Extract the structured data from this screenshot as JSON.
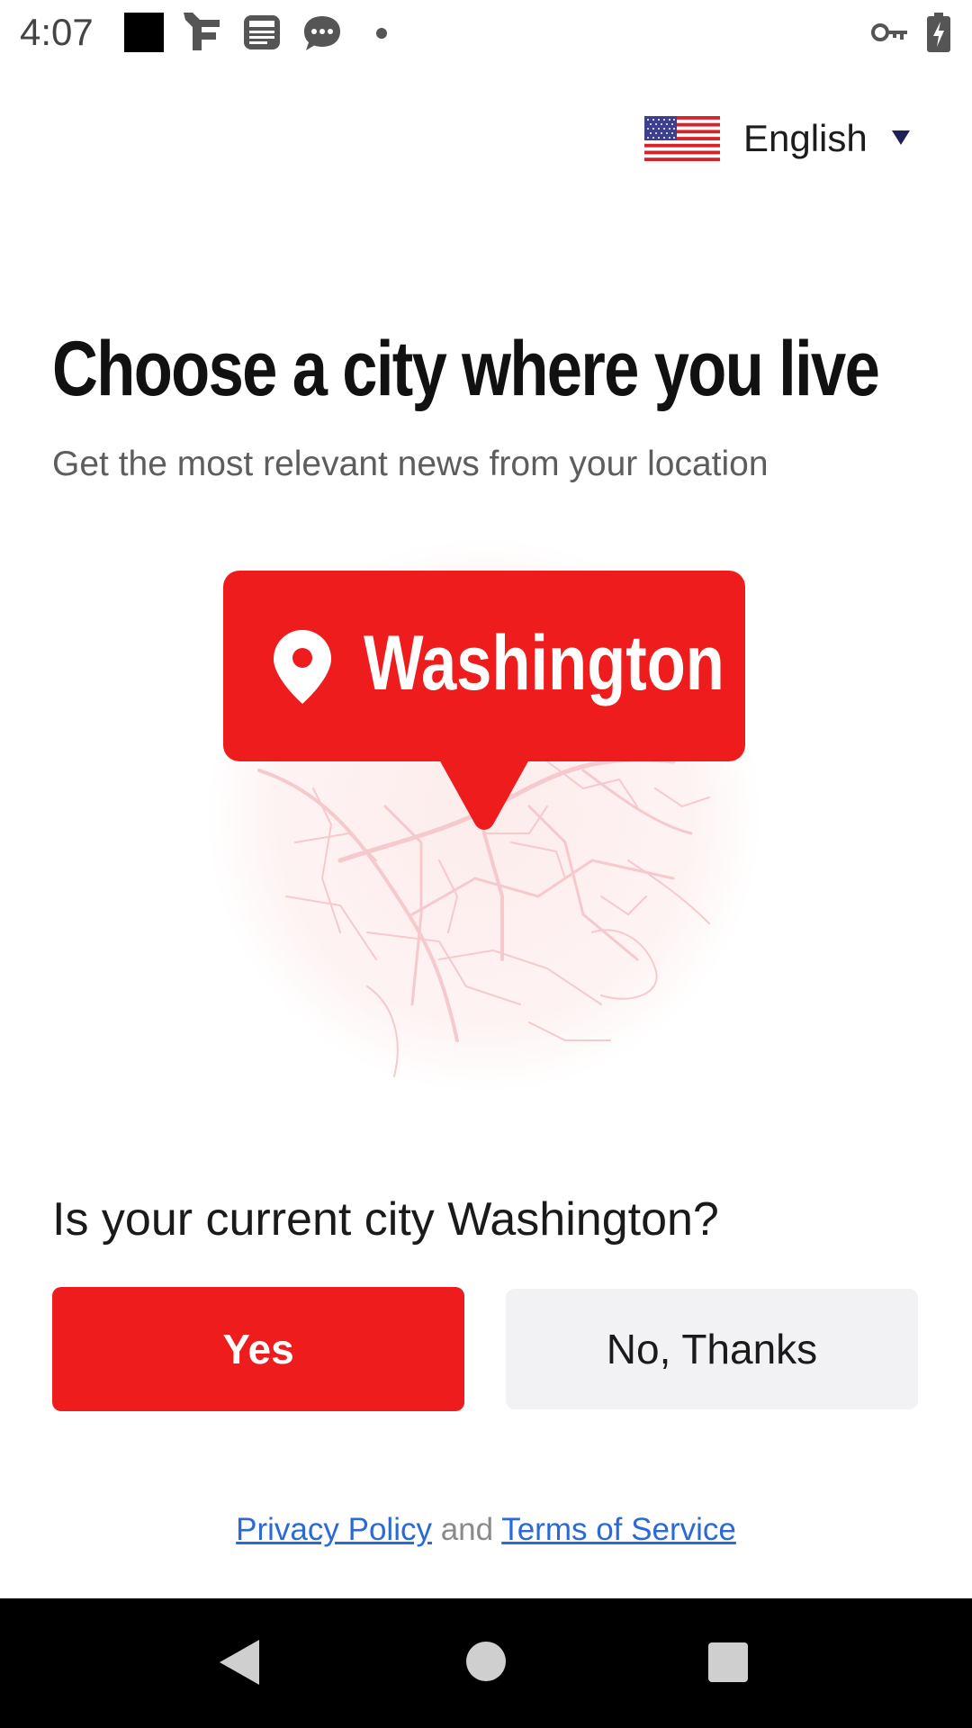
{
  "status_bar": {
    "time": "4:07",
    "icons": [
      "black-square-icon",
      "f-app-icon",
      "news-icon",
      "chat-bubble-icon",
      "dot-icon",
      "vpn-key-icon",
      "battery-charging-icon"
    ]
  },
  "language": {
    "flag": "us-flag-icon",
    "label": "English",
    "caret": "caret-down-icon"
  },
  "header": {
    "title": "Choose a city where you live",
    "subtitle": "Get the most relevant news from your location"
  },
  "callout": {
    "icon": "location-pin-icon",
    "city": "Washington"
  },
  "question": {
    "text": "Is your current city Washington?"
  },
  "buttons": {
    "yes_label": "Yes",
    "no_label": "No, Thanks"
  },
  "legal": {
    "privacy_label": "Privacy Policy",
    "connector": "and",
    "terms_label": "Terms of Service"
  },
  "nav_bar": {
    "back": "back-icon",
    "home": "home-icon",
    "recents": "recents-icon"
  },
  "colors": {
    "accent": "#ee1c1c",
    "secondary_button": "#f2f2f4",
    "link": "#2a6ad6",
    "title_text": "#111111",
    "subtitle_text": "#5d5d5d",
    "nav_bar": "#000000"
  }
}
